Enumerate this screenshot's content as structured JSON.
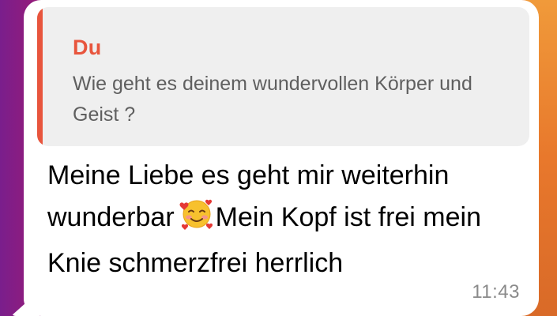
{
  "quoted_message": {
    "author": "Du",
    "text": "Wie geht es deinem wundervollen Körper und Geist ?"
  },
  "message": {
    "text_part1": "Meine Liebe es geht mir weiterhin wunderbar",
    "emoji": "smiling-face-with-hearts-icon",
    "text_part2": "Mein Kopf ist frei mein Knie schmerzfrei herrlich",
    "time": "11:43"
  },
  "colors": {
    "quote_accent": "#e8553d",
    "bubble": "#ffffff",
    "quote_background": "#efefef"
  }
}
